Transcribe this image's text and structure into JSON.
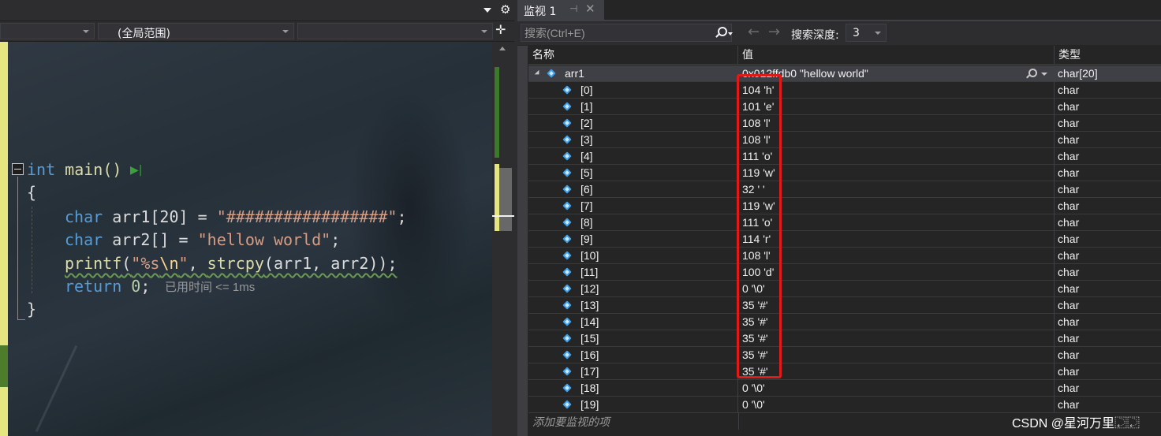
{
  "editor": {
    "nav_scope": "(全局范围)",
    "code": {
      "kw_int": "int",
      "main_fn": "main()",
      "open_brace": "{",
      "close_brace": "}",
      "line1": {
        "kw": "char",
        "name": " arr1",
        "rest": "[20] = ",
        "str": "\"#################\"",
        "end": ";"
      },
      "line2": {
        "kw": "char",
        "name": " arr2",
        "rest": "[] = ",
        "str": "\"hellow world\"",
        "end": ";"
      },
      "line3": {
        "fn": "printf",
        "p1": "(",
        "s1": "\"%s",
        "esc": "\\n",
        "s2": "\"",
        "p2": ", ",
        "fn2": "strcpy",
        "args": "(arr1, arr2));"
      },
      "line4": {
        "kw": "return",
        "sp": " ",
        "num": "0",
        "end": ";"
      }
    },
    "perf_tip": "已用时间 <= 1ms"
  },
  "watch": {
    "tab_label": "监视 1",
    "pin_icon": "pin-icon",
    "close_icon": "close-icon",
    "search_placeholder": "搜索(Ctrl+E)",
    "back_icon": "←",
    "fwd_icon": "→",
    "depth_label": "搜索深度:",
    "depth_value": "3",
    "headers": {
      "name": "名称",
      "value": "值",
      "type": "类型"
    },
    "root": {
      "name": "arr1",
      "value": "0x012ffdb0 \"hellow world\"",
      "type": "char[20]"
    },
    "items": [
      {
        "name": "[0]",
        "value": "104 'h'",
        "type": "char"
      },
      {
        "name": "[1]",
        "value": "101 'e'",
        "type": "char"
      },
      {
        "name": "[2]",
        "value": "108 'l'",
        "type": "char"
      },
      {
        "name": "[3]",
        "value": "108 'l'",
        "type": "char"
      },
      {
        "name": "[4]",
        "value": "111 'o'",
        "type": "char"
      },
      {
        "name": "[5]",
        "value": "119 'w'",
        "type": "char"
      },
      {
        "name": "[6]",
        "value": "32 ' '",
        "type": "char"
      },
      {
        "name": "[7]",
        "value": "119 'w'",
        "type": "char"
      },
      {
        "name": "[8]",
        "value": "111 'o'",
        "type": "char"
      },
      {
        "name": "[9]",
        "value": "114 'r'",
        "type": "char"
      },
      {
        "name": "[10]",
        "value": "108 'l'",
        "type": "char"
      },
      {
        "name": "[11]",
        "value": "100 'd'",
        "type": "char"
      },
      {
        "name": "[12]",
        "value": "0 '\\0'",
        "type": "char"
      },
      {
        "name": "[13]",
        "value": "35 '#'",
        "type": "char"
      },
      {
        "name": "[14]",
        "value": "35 '#'",
        "type": "char"
      },
      {
        "name": "[15]",
        "value": "35 '#'",
        "type": "char"
      },
      {
        "name": "[16]",
        "value": "35 '#'",
        "type": "char"
      },
      {
        "name": "[17]",
        "value": "35 '#'",
        "type": "char"
      },
      {
        "name": "[18]",
        "value": "0 '\\0'",
        "type": "char"
      },
      {
        "name": "[19]",
        "value": "0 '\\0'",
        "type": "char"
      }
    ],
    "add_item": "添加要监视的项"
  },
  "watermark": "CSDN @星河万里⿿⿿",
  "colors": {
    "highlight": "#e01919",
    "keyword": "#569cd6",
    "string": "#d69d85",
    "accent_gutter": "#e6e681"
  }
}
